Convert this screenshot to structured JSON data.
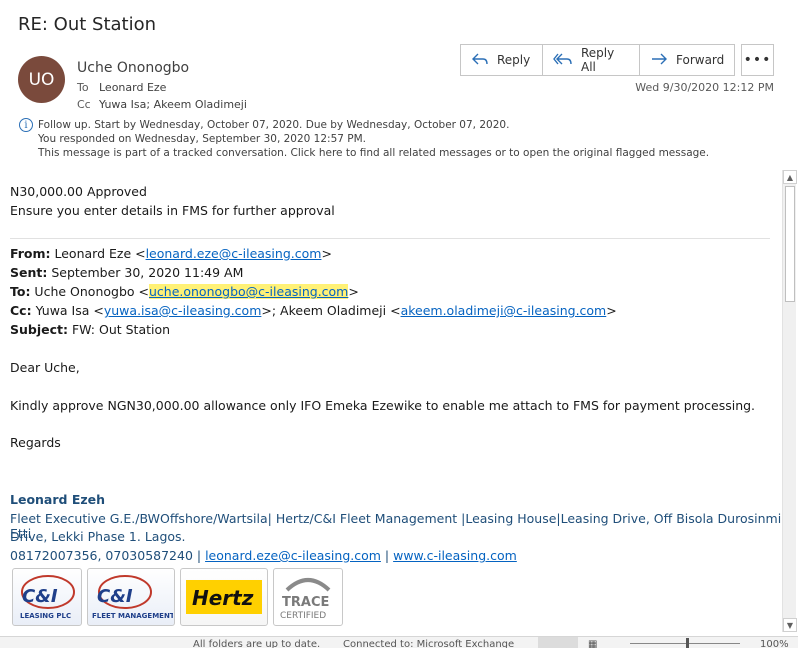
{
  "message": {
    "subject": "RE: Out Station",
    "avatar_initials": "UO",
    "sender": "Uche Ononogbo",
    "to_label": "To",
    "to": "Leonard Eze",
    "cc_label": "Cc",
    "cc": "Yuwa Isa; Akeem Oladimeji",
    "date": "Wed 9/30/2020 12:12 PM"
  },
  "actions": {
    "reply": "Reply",
    "reply_all": "Reply All",
    "forward": "Forward",
    "more": "•••"
  },
  "info": {
    "line1": "Follow up.  Start by Wednesday, October 07, 2020.  Due by Wednesday, October 07, 2020.",
    "line2": "You responded  on Wednesday, September 30, 2020 12:57 PM.",
    "line3": "This message is part of a tracked conversation. Click here to find all related messages or to open the original flagged message."
  },
  "body": {
    "line1": "N30,000.00 Approved",
    "line2": "Ensure you enter details in FMS for further approval",
    "from_label": "From:",
    "from_name": " Leonard Eze <",
    "from_email": "leonard.eze@c-ileasing.com",
    "sent_label": "Sent:",
    "sent": " September 30, 2020 11:49 AM",
    "to_label": "To:",
    "to_name": " Uche Ononogbo <",
    "to_email": "uche.ononogbo@c-ileasing.com",
    "cc_label": "Cc:",
    "cc_name1": " Yuwa Isa <",
    "cc_email1": "yuwa.isa@c-ileasing.com",
    "cc_name2": ">; Akeem Oladimeji <",
    "cc_email2": "akeem.oladimeji@c-ileasing.com",
    "subject_label": "Subject:",
    "subject": " FW: Out Station",
    "greeting": "Dear Uche,",
    "content": "Kindly approve NGN30,000.00 allowance only IFO Emeka Ezewike to enable me attach to FMS for payment processing.",
    "closing": "Regards",
    "sig_name": "Leonard Ezeh",
    "sig_title1": "Fleet Executive G.E./BWOffshore/Wartsila| Hertz/C&I Fleet Management |Leasing House|Leasing Drive, Off Bisola Durosinmi Etti",
    "sig_title2": "Drive, Lekki Phase 1. Lagos.",
    "sig_phones": "08172007356, 07030587240 | ",
    "sig_email": "leonard.eze@c-ileasing.com",
    "sig_sep": " | ",
    "sig_web": "www.c-ileasing.com"
  },
  "logos": {
    "ci_short": "C&I",
    "ci_leasing": "LEASING PLC",
    "ci_fleet": "FLEET MANAGEMENT",
    "hertz": "Hertz",
    "trace1": "TRACE",
    "trace2": "CERTIFIED"
  },
  "status": {
    "left": "All folders are up to date.",
    "connection": "Connected to: Microsoft Exchange",
    "zoom": "100%"
  },
  "colors": {
    "avatar": "#7a4a3c",
    "accent": "#2b6fb6",
    "link": "#0563c1",
    "signature": "#1f4e79",
    "highlight": "#fff176"
  }
}
